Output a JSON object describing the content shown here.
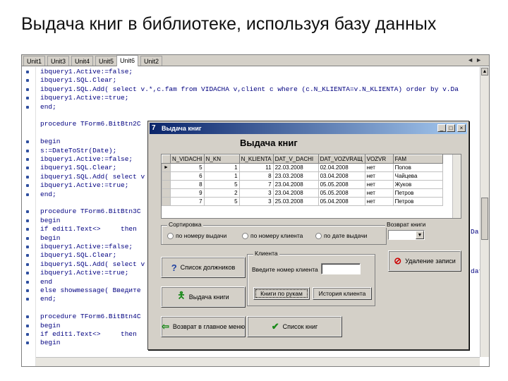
{
  "slide": {
    "title": "Выдача книг в библиотеке, используя базу данных"
  },
  "editor": {
    "tabs": [
      "Unit1",
      "Unit3",
      "Unit4",
      "Unit5",
      "Unit6",
      "Unit2"
    ],
    "active_tab": 4,
    "lines": [
      "ibquery1.Active:=false;",
      "ibquery1.SQL.Clear;",
      "ibquery1.SQL.Add( select v.*,c.fam from VIDACHA v,client c where (c.N_KLIENTA=v.N_KLIENTA) order by v.Da",
      "ibquery1.Active:=true;",
      "end;",
      "",
      "procedure TForm6.BitBtn2C",
      "",
      "begin",
      "s:=DateToStr(Date);",
      "ibquery1.Active:=false;",
      "ibquery1.SQL.Clear;",
      "ibquery1.SQL.Add( select v",
      "ibquery1.Active:=true;",
      "end;",
      "",
      "procedure TForm6.BitBtn3C",
      "begin",
      "if edit1.Text<>     then",
      "begin",
      "ibquery1.Active:=false;",
      "ibquery1.SQL.Clear;",
      "ibquery1.SQL.Add( select v",
      "ibquery1.Active:=true;",
      "end",
      "else showmessage( Введите",
      "end;",
      "",
      "procedure TForm6.BitBtn4C",
      "begin",
      "if edit1.Text<>     then",
      "begin"
    ],
    "right_fragments": [
      "Da",
      "Da",
      "dat"
    ]
  },
  "dialog": {
    "title": "Выдача книг",
    "heading": "Выдача книг",
    "grid": {
      "columns": [
        "N_VIDACHI",
        "N_KN",
        "N_KLIENTA",
        "DAT_V_DACHI",
        "DAT_VOZVRAЩ",
        "VOZVR",
        "FAM"
      ],
      "rows": [
        [
          "5",
          "1",
          "11",
          "22.03.2008",
          "02.04.2008",
          "нет",
          "Попов"
        ],
        [
          "6",
          "1",
          "8",
          "23.03.2008",
          "03.04.2008",
          "нет",
          "Чайцева"
        ],
        [
          "8",
          "5",
          "7",
          "23.04.2008",
          "05.05.2008",
          "нет",
          "Жуков"
        ],
        [
          "9",
          "2",
          "3",
          "23.04.2008",
          "05.05.2008",
          "нет",
          "Петров"
        ],
        [
          "7",
          "5",
          "3",
          "25.03.2008",
          "05.04.2008",
          "нет",
          "Петров"
        ]
      ]
    },
    "sort_group": {
      "label": "Сортировка",
      "options": [
        "по номеру выдачи",
        "по номеру клиента",
        "по дате выдачи"
      ]
    },
    "return_group": {
      "label": "Возврат книги"
    },
    "client_group": {
      "label": "Клиента",
      "prompt": "Введите номер клиента",
      "input_value": ""
    },
    "buttons": {
      "debtors": "Список должников",
      "issue": "Выдача книги",
      "back": "Возврат в главное меню",
      "books": "Список книг",
      "delete": "Удаление записи",
      "books_in_hand": "Книги по рукам",
      "history": "История клиента"
    },
    "colors": {
      "title_bar": "#0a246a",
      "ok_green": "#1a8a1a",
      "delete_red": "#cc0000",
      "help_blue": "#2040a0"
    }
  }
}
